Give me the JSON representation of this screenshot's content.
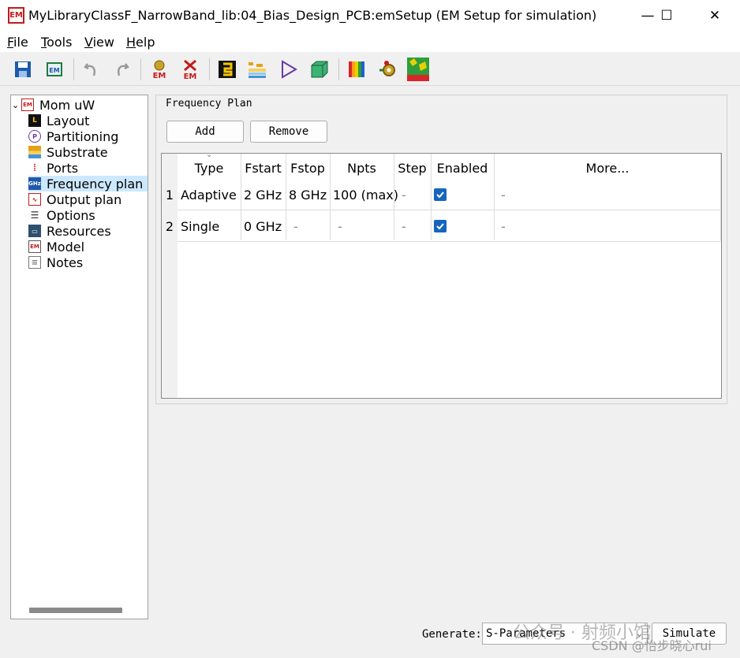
{
  "window": {
    "app_icon_text": "EM",
    "title": "MyLibraryClassF_NarrowBand_lib:04_Bias_Design_PCB:emSetup (EM Setup for simulation)",
    "minimize": "—",
    "maximize": "☐",
    "close": "✕"
  },
  "menu": [
    {
      "key": "F",
      "rest": "ile"
    },
    {
      "key": "T",
      "rest": "ools"
    },
    {
      "key": "V",
      "rest": "iew"
    },
    {
      "key": "H",
      "rest": "elp"
    }
  ],
  "toolbar": {
    "icons": [
      "save-icon",
      "em-import-icon",
      "undo-icon",
      "redo-icon",
      "em-simulate-icon",
      "em-stop-icon",
      "layout-icon",
      "substrate-icon",
      "port-icon",
      "3d-view-icon",
      "color-palette-icon",
      "settings-gear-icon",
      "field-plot-icon"
    ]
  },
  "tree": {
    "root": "Mom uW",
    "items": [
      "Layout",
      "Partitioning",
      "Substrate",
      "Ports",
      "Frequency plan",
      "Output plan",
      "Options",
      "Resources",
      "Model",
      "Notes"
    ],
    "selected": "Frequency plan"
  },
  "frequency_plan": {
    "group_title": "Frequency Plan",
    "add_label": "Add",
    "remove_label": "Remove",
    "columns": [
      "Type",
      "Fstart",
      "Fstop",
      "Npts",
      "Step",
      "Enabled",
      "More..."
    ],
    "rows": [
      {
        "num": "1",
        "type": "Adaptive",
        "fstart": "2 GHz",
        "fstop": "8 GHz",
        "npts": "100 (max)",
        "step": "-",
        "enabled": true,
        "more": "-"
      },
      {
        "num": "2",
        "type": "Single",
        "fstart": "0 GHz",
        "fstop": "-",
        "npts": "-",
        "step": "-",
        "enabled": true,
        "more": "-"
      }
    ]
  },
  "footer": {
    "generate_label": "Generate:",
    "generate_value": "S-Parameters",
    "simulate_label": "Simulate"
  },
  "watermark": {
    "line1": "公众号 · 射频小馆",
    "line2": "CSDN @怡步晓心rui"
  }
}
